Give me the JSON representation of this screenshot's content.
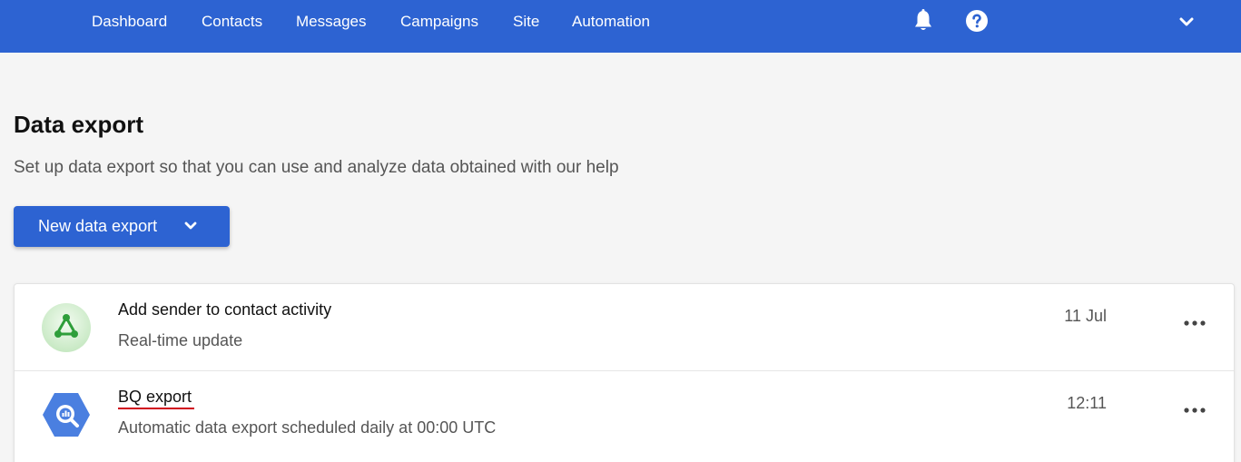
{
  "nav": {
    "items": [
      {
        "label": "Dashboard"
      },
      {
        "label": "Contacts"
      },
      {
        "label": "Messages"
      },
      {
        "label": "Campaigns"
      },
      {
        "label": "Site"
      },
      {
        "label": "Automation"
      }
    ],
    "icons": [
      "bell-icon",
      "help-icon",
      "chevron-down-icon"
    ]
  },
  "page": {
    "title": "Data export",
    "description": "Set up data export so that you can use and analyze data obtained with our help",
    "new_button_label": "New data export"
  },
  "exports": [
    {
      "title": "Add sender to contact activity",
      "subtitle": "Real-time update",
      "time": "11 Jul",
      "icon": "webhook-icon"
    },
    {
      "title": "BQ export",
      "subtitle": "Automatic data export scheduled daily at 00:00 UTC",
      "time": "12:11",
      "icon": "bigquery-icon"
    }
  ],
  "colors": {
    "brand": "#2d63d2",
    "webhook": "#2e9e3a",
    "bigquery": "#4a7fe0",
    "underline": "#d0021b"
  }
}
